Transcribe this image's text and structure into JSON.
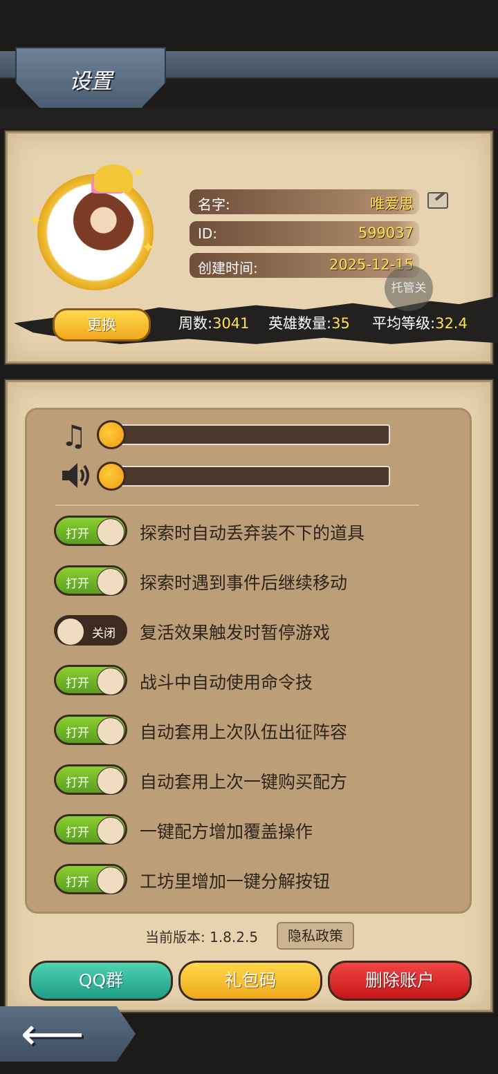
{
  "header": {
    "title": "设置"
  },
  "profile": {
    "name_label": "名字:",
    "name_value": "唯爱思",
    "id_label": "ID:",
    "id_value": "599037",
    "created_label": "创建时间:",
    "created_value": "2025-12-15",
    "trust_label": "托管关",
    "change_label": "更换"
  },
  "stats": {
    "weeks_label": "周数:",
    "weeks_value": "3041",
    "heroes_label": "英雄数量:",
    "heroes_value": "35",
    "avg_level_label": "平均等级:",
    "avg_level_value": "32.4"
  },
  "audio": {
    "music_level": 0,
    "sound_level": 0
  },
  "options": [
    {
      "state": "打开",
      "on": true,
      "label": "探索时自动丢弃装不下的道具"
    },
    {
      "state": "打开",
      "on": true,
      "label": "探索时遇到事件后继续移动"
    },
    {
      "state": "关闭",
      "on": false,
      "label": "复活效果触发时暂停游戏"
    },
    {
      "state": "打开",
      "on": true,
      "label": "战斗中自动使用命令技"
    },
    {
      "state": "打开",
      "on": true,
      "label": "自动套用上次队伍出征阵容"
    },
    {
      "state": "打开",
      "on": true,
      "label": "自动套用上次一键购买配方"
    },
    {
      "state": "打开",
      "on": true,
      "label": "一键配方增加覆盖操作"
    },
    {
      "state": "打开",
      "on": true,
      "label": "工坊里增加一键分解按钮"
    }
  ],
  "footer": {
    "version": "当前版本: 1.8.2.5",
    "privacy": "隐私政策",
    "qq": "QQ群",
    "gift": "礼包码",
    "delete": "删除账户"
  }
}
